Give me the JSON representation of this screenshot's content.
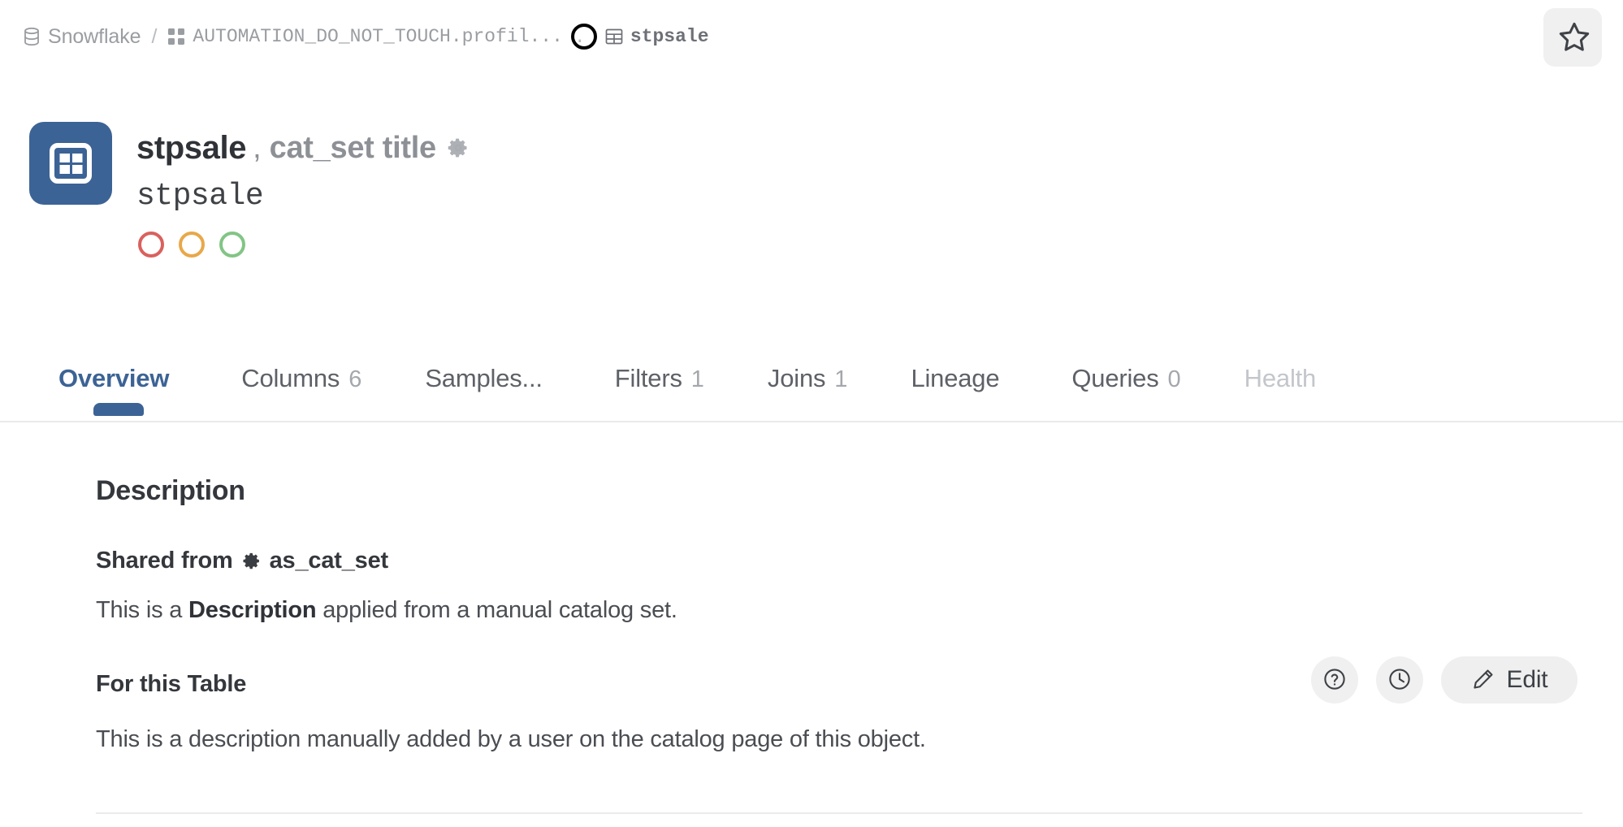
{
  "breadcrumb": {
    "items": [
      {
        "label": "Snowflake",
        "icon": "database-icon"
      },
      {
        "label": "AUTOMATION_DO_NOT_TOUCH.profil...",
        "icon": "schema-grid-icon"
      },
      {
        "label": "stpsale",
        "icon": "table-icon"
      }
    ],
    "separator": "/",
    "dot_separator": "."
  },
  "favorite_button": {
    "icon": "star-icon"
  },
  "header": {
    "icon": "table-icon",
    "title": "stpsale",
    "comma": ",",
    "alias": "cat_set title",
    "alias_gear_icon": "gear-icon",
    "qualified_name": "stpsale",
    "status_dots": [
      {
        "name": "status-dot-red",
        "color": "#d9615e"
      },
      {
        "name": "status-dot-amber",
        "color": "#e8a84a"
      },
      {
        "name": "status-dot-green",
        "color": "#82c585"
      }
    ]
  },
  "tabs": [
    {
      "label": "Overview",
      "count": "",
      "active": true,
      "disabled": false
    },
    {
      "label": "Columns",
      "count": "6",
      "active": false,
      "disabled": false
    },
    {
      "label": "Samples...",
      "count": "",
      "active": false,
      "disabled": false
    },
    {
      "label": "Filters",
      "count": "1",
      "active": false,
      "disabled": false
    },
    {
      "label": "Joins",
      "count": "1",
      "active": false,
      "disabled": false
    },
    {
      "label": "Lineage",
      "count": "",
      "active": false,
      "disabled": false
    },
    {
      "label": "Queries",
      "count": "0",
      "active": false,
      "disabled": false
    },
    {
      "label": "Health",
      "count": "",
      "active": false,
      "disabled": true
    }
  ],
  "description": {
    "section_title": "Description",
    "shared_from": {
      "prefix": "Shared from",
      "gear_icon": "gear-icon",
      "source": "as_cat_set"
    },
    "shared_text_1": "This is a ",
    "shared_text_bold": "Description",
    "shared_text_2": " applied from a manual catalog set.",
    "for_this_table_title": "For this Table",
    "for_this_table_text": "This is a description manually added by a user on the catalog page of this object."
  },
  "actions": {
    "help_icon": "question-circle-icon",
    "history_icon": "clock-icon",
    "edit_icon": "pencil-icon",
    "edit_label": "Edit"
  },
  "colors": {
    "brand_blue": "#3c6395",
    "muted_text": "#9a9da1",
    "body_text": "#4a4d52"
  }
}
